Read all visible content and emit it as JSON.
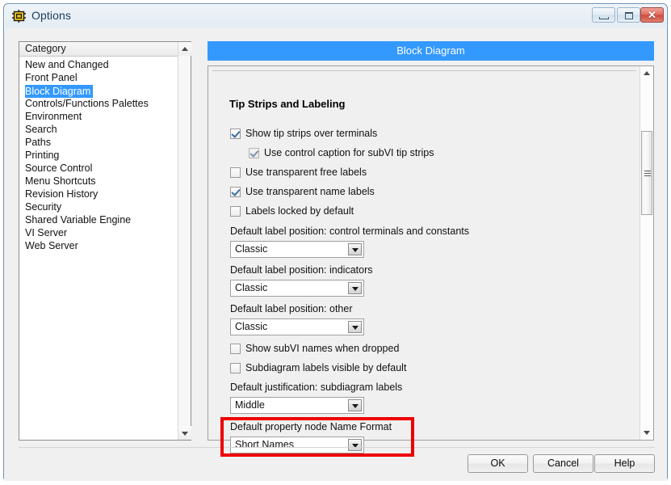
{
  "window": {
    "title": "Options",
    "icon": "labview-vi-icon",
    "controls": {
      "minimize": "minimize-icon",
      "maximize": "maximize-icon",
      "close": "✕"
    }
  },
  "category": {
    "header": "Category",
    "items": [
      {
        "label": "New and Changed",
        "selected": false
      },
      {
        "label": "Front Panel",
        "selected": false
      },
      {
        "label": "Block Diagram",
        "selected": true
      },
      {
        "label": "Controls/Functions Palettes",
        "selected": false
      },
      {
        "label": "Environment",
        "selected": false
      },
      {
        "label": "Search",
        "selected": false
      },
      {
        "label": "Paths",
        "selected": false
      },
      {
        "label": "Printing",
        "selected": false
      },
      {
        "label": "Source Control",
        "selected": false
      },
      {
        "label": "Menu Shortcuts",
        "selected": false
      },
      {
        "label": "Revision History",
        "selected": false
      },
      {
        "label": "Security",
        "selected": false
      },
      {
        "label": "Shared Variable Engine",
        "selected": false
      },
      {
        "label": "VI Server",
        "selected": false
      },
      {
        "label": "Web Server",
        "selected": false
      }
    ]
  },
  "main": {
    "header": "Block Diagram",
    "section_title": "Tip Strips and Labeling",
    "checkboxes": [
      {
        "label": "Show tip strips over terminals",
        "checked": true,
        "dim": false
      },
      {
        "label": "Use control caption for subVI tip strips",
        "checked": true,
        "dim": true
      },
      {
        "label": "Use transparent free labels",
        "checked": false,
        "dim": false
      },
      {
        "label": "Use transparent name labels",
        "checked": true,
        "dim": false
      },
      {
        "label": "Labels locked by default",
        "checked": false,
        "dim": false
      },
      {
        "label": "Show subVI names when dropped",
        "checked": false,
        "dim": false
      },
      {
        "label": "Subdiagram labels visible by default",
        "checked": false,
        "dim": false
      }
    ],
    "combos": [
      {
        "label": "Default label position: control terminals and constants",
        "value": "Classic"
      },
      {
        "label": "Default label position: indicators",
        "value": "Classic"
      },
      {
        "label": "Default label position: other",
        "value": "Classic"
      },
      {
        "label": "Default justification: subdiagram labels",
        "value": "Middle"
      },
      {
        "label": "Default property node Name Format",
        "value": "Short Names"
      }
    ],
    "highlight_color": "#ee0000",
    "accent_color": "#3399ff"
  },
  "buttons": {
    "ok": "OK",
    "cancel": "Cancel",
    "help": "Help"
  }
}
